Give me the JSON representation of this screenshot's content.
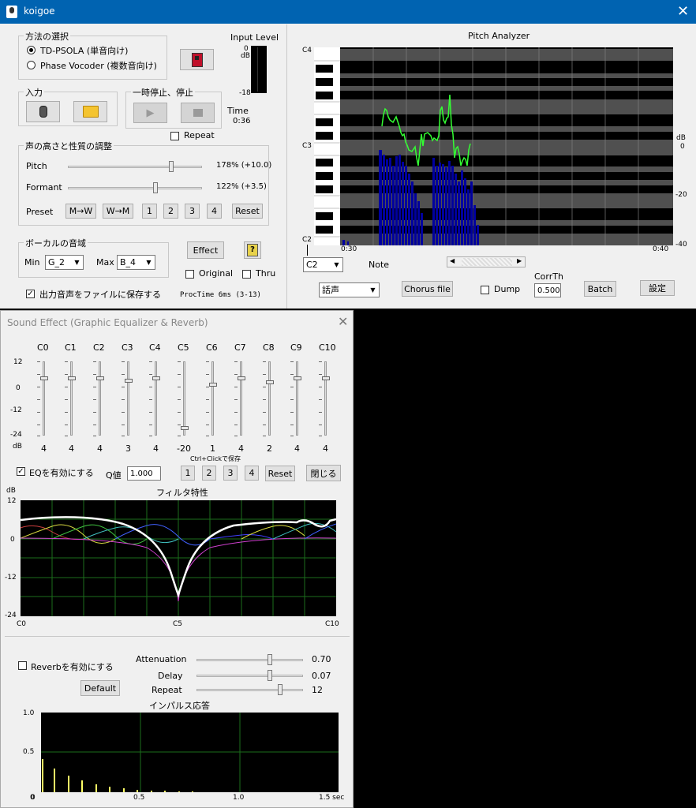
{
  "main": {
    "title": "koigoe",
    "method": {
      "title": "方法の選択",
      "opt1": "TD-PSOLA (単音向け)",
      "opt2": "Phase Vocoder (複数音向け)"
    },
    "input_level": {
      "label": "Input Level",
      "top": "0",
      "unit": "dB",
      "bottom": "-18"
    },
    "input": {
      "title": "入力"
    },
    "pause": {
      "title": "一時停止、停止"
    },
    "time": {
      "label": "Time",
      "value": "0:36"
    },
    "repeat_label": "Repeat",
    "adjust": {
      "title": "声の高さと性質の調整",
      "pitch_label": "Pitch",
      "pitch_value": "178% (+10.0)",
      "pitch_level": 0.78,
      "formant_label": "Formant",
      "formant_value": "122% (+3.5)",
      "formant_level": 0.66,
      "preset_label": "Preset",
      "buttons": [
        "M→W",
        "W→M",
        "1",
        "2",
        "3",
        "4",
        "Reset"
      ]
    },
    "range": {
      "title": "ボーカルの音域",
      "min_label": "Min",
      "min_value": "G_2",
      "max_label": "Max",
      "max_value": "B_4"
    },
    "effect_button": "Effect",
    "help_button": "?",
    "original_label": "Original",
    "thru_label": "Thru",
    "save_label": "出力音声をファイルに保存する",
    "proctime": "ProcTime 6ms (3-13)",
    "analyzer": {
      "title": "Pitch Analyzer",
      "c4": "C4",
      "c3": "C3",
      "c2": "C2",
      "db_label": "dB",
      "db0": "0",
      "db20": "-20",
      "db40": "-40",
      "time_start": "0:30",
      "time_end": "0:40",
      "note_select": "C2",
      "note_label": "Note",
      "voice_select": "話声",
      "chorus_button": "Chorus file",
      "dump_label": "Dump",
      "corrth_label": "CorrTh",
      "corrth_value": "0.500",
      "batch_button": "Batch",
      "settings_button": "設定"
    }
  },
  "eq": {
    "title": "Sound Effect (Graphic Equalizer & Reverb)",
    "bands": [
      "C0",
      "C1",
      "C2",
      "C3",
      "C4",
      "C5",
      "C6",
      "C7",
      "C8",
      "C9",
      "C10"
    ],
    "values": [
      "4",
      "4",
      "4",
      "3",
      "4",
      "-20",
      "1",
      "4",
      "2",
      "4",
      "4"
    ],
    "levels": [
      4,
      4,
      4,
      3,
      4,
      -20,
      1,
      4,
      2,
      4,
      4
    ],
    "scale": [
      "12",
      "0",
      "-12",
      "-24"
    ],
    "db_label": "dB",
    "ctrl_hint": "Ctrl+Clickで保存",
    "enable_label": "EQを有効にする",
    "q_label": "Q値",
    "q_value": "1.000",
    "preset_buttons": [
      "1",
      "2",
      "3",
      "4"
    ],
    "reset_button": "Reset",
    "close_button": "閉じる",
    "filter": {
      "title": "フィルタ特性",
      "db_label": "dB",
      "y_ticks": [
        "12",
        "0",
        "-12",
        "-24"
      ],
      "x_ticks": [
        "C0",
        "C5",
        "C10"
      ]
    },
    "reverb": {
      "enable_label": "Reverbを有効にする",
      "default_button": "Default",
      "attenuation_label": "Attenuation",
      "attenuation_value": "0.70",
      "attenuation_level": 0.7,
      "delay_label": "Delay",
      "delay_value": "0.07",
      "delay_level": 0.7,
      "repeat_label": "Repeat",
      "repeat_value": "12",
      "repeat_level": 0.8
    },
    "impulse": {
      "title": "インパルス応答",
      "y_ticks": [
        "1.0",
        "0.5",
        "0"
      ],
      "x_ticks": [
        "0",
        "0.5",
        "1.0",
        "1.5 sec"
      ]
    }
  },
  "colors": {
    "titlebar": "#0063b1",
    "plot_bg": "#000000",
    "grid": "#1b6e1b",
    "pitch_line": "#33ff33",
    "spectrum": "#00009f"
  }
}
